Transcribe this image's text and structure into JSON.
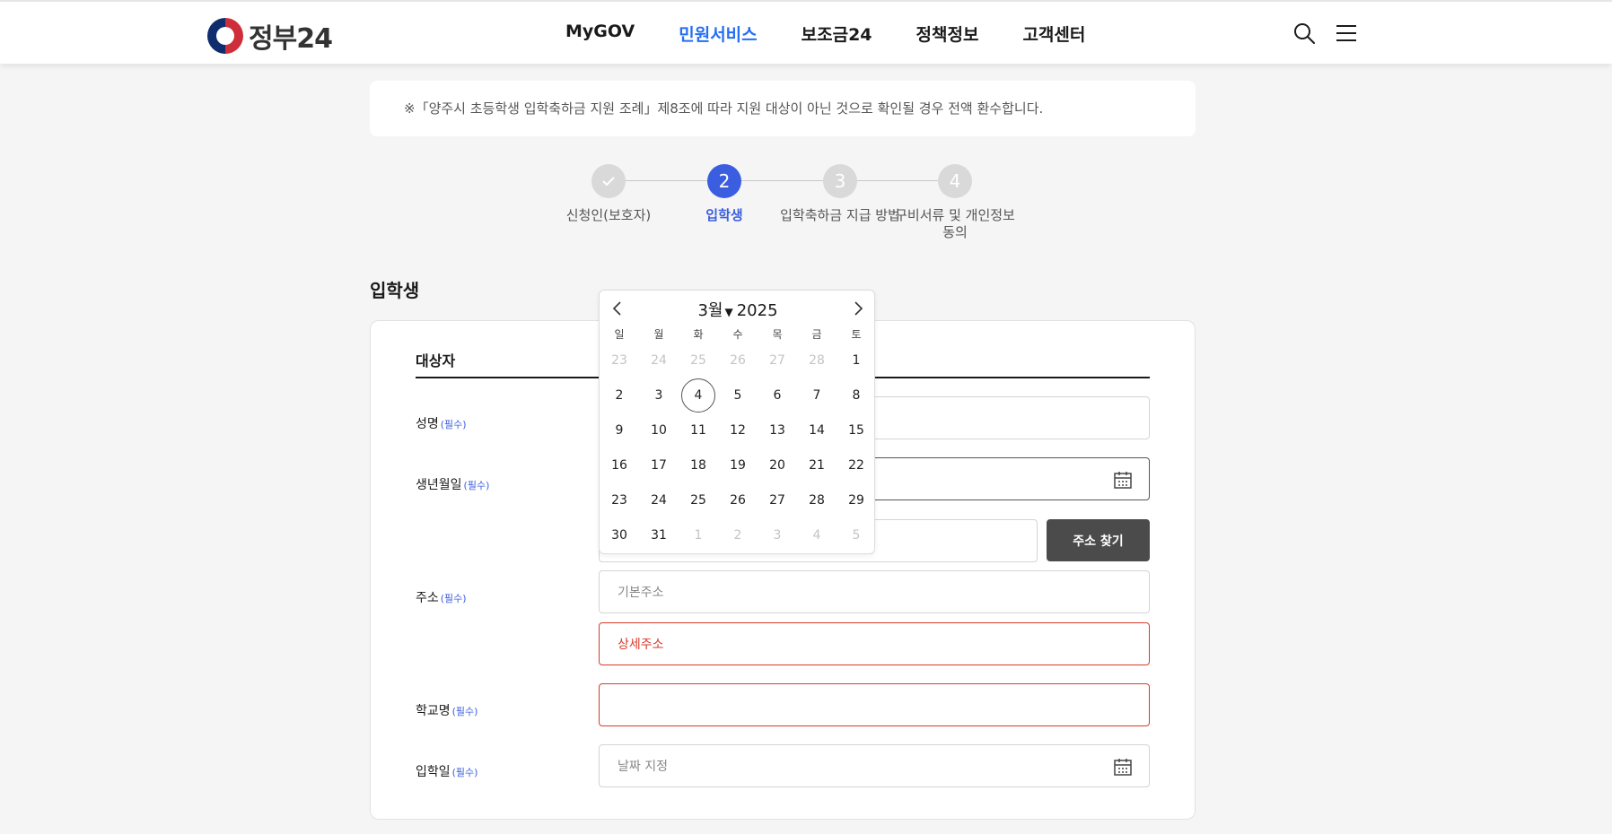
{
  "header": {
    "logo_text": "정부24",
    "nav": [
      "MyGOV",
      "민원서비스",
      "보조금24",
      "정책정보",
      "고객센터"
    ],
    "active_nav": "민원서비스"
  },
  "notice": "※「양주시 초등학생 입학축하금 지원 조례」제8조에 따라 지원 대상이 아닌 것으로 확인될 경우 전액 환수합니다.",
  "steps": [
    {
      "num": "2",
      "label": "입학생"
    },
    {
      "num": "3",
      "label": "입학축하금 지급 방법"
    },
    {
      "num": "4",
      "label": "구비서류 및 개인정보 동의"
    }
  ],
  "step1_label": "신청인(보호자)",
  "step4_label_line1": "구비서류 및 개인정보",
  "step4_label_line2": "동의",
  "section_title": "입학생",
  "card": {
    "title": "대상자",
    "required": "(필수)",
    "labels": {
      "name": "성명",
      "birth": "생년월일",
      "address": "주소",
      "school": "학교명",
      "entry_date": "입학일"
    },
    "address_search_button": "주소 찾기",
    "placeholders": {
      "base_address": "기본주소",
      "detail_address": "상세주소",
      "entry_date": "날짜 지정"
    }
  },
  "datepicker": {
    "month": "3월",
    "year": "2025",
    "weekdays": [
      "일",
      "월",
      "화",
      "수",
      "목",
      "금",
      "토"
    ],
    "today": "4",
    "weeks": [
      [
        "23",
        "24",
        "25",
        "26",
        "27",
        "28",
        "1"
      ],
      [
        "2",
        "3",
        "4",
        "5",
        "6",
        "7",
        "8"
      ],
      [
        "9",
        "10",
        "11",
        "12",
        "13",
        "14",
        "15"
      ],
      [
        "16",
        "17",
        "18",
        "19",
        "20",
        "21",
        "22"
      ],
      [
        "23",
        "24",
        "25",
        "26",
        "27",
        "28",
        "29"
      ],
      [
        "30",
        "31",
        "1",
        "2",
        "3",
        "4",
        "5"
      ]
    ]
  },
  "colors": {
    "accent": "#3b5ee0",
    "nav_active": "#256ef4",
    "error": "#d93a2b",
    "button_dark": "#4b4b4b"
  },
  "icons": [
    "search-icon",
    "menu-icon",
    "calendar-icon",
    "check-icon",
    "chevron-left-icon",
    "chevron-right-icon",
    "chevron-down-icon"
  ]
}
